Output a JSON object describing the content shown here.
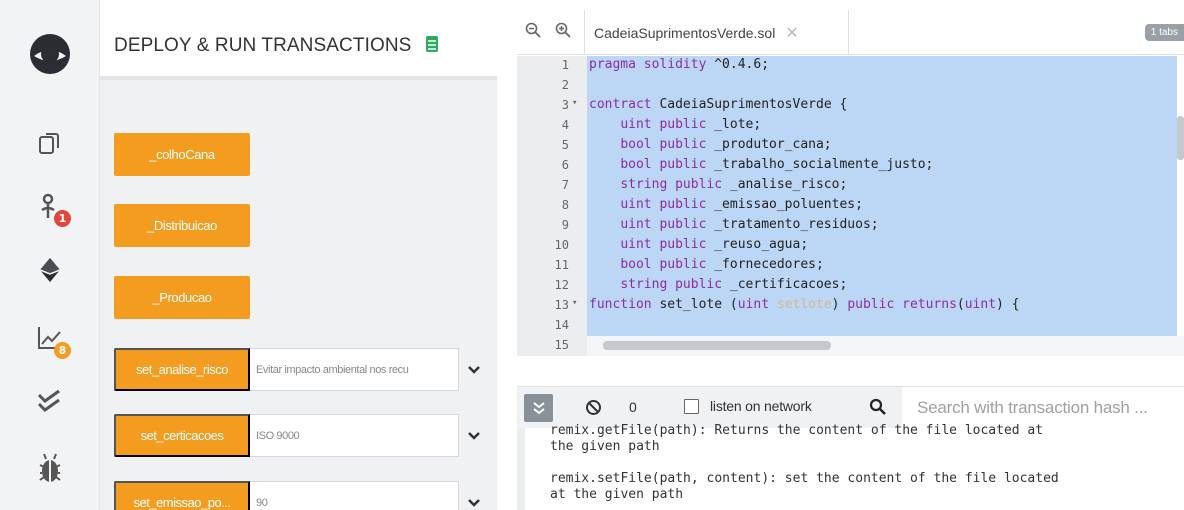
{
  "panel": {
    "title": "DEPLOY & RUN TRANSACTIONS",
    "buttons": [
      {
        "label": "_colhoCana"
      },
      {
        "label": "_Distribuicao"
      },
      {
        "label": "_Producao"
      }
    ],
    "rows": [
      {
        "label": "set_analise_risco",
        "value": "Evitar impacto ambiental nos recu"
      },
      {
        "label": "set_certicacoes",
        "value": "ISO 9000"
      },
      {
        "label": "set_emissao_po...",
        "value": "90"
      }
    ]
  },
  "rail": {
    "badges": {
      "plugin": "1",
      "analysis": "8"
    },
    "colors": {
      "badge_red": "#e2453c",
      "badge_orange": "#f39c1f"
    }
  },
  "editor": {
    "file_tab": "CadeiaSuprimentosVerde.sol",
    "tab_pill": "1 tabs",
    "lines": [
      {
        "n": "1",
        "fold": "",
        "parts": [
          [
            "kw",
            "pragma solidity "
          ],
          [
            "nm",
            "^0.4.6;"
          ]
        ]
      },
      {
        "n": "2",
        "fold": "",
        "parts": []
      },
      {
        "n": "3",
        "fold": "▾",
        "parts": [
          [
            "kw",
            "contract "
          ],
          [
            "nm",
            "CadeiaSuprimentosVerde {"
          ]
        ]
      },
      {
        "n": "4",
        "fold": "",
        "parts": [
          [
            "nm",
            "    "
          ],
          [
            "kw",
            "uint public "
          ],
          [
            "nm",
            "_lote;"
          ]
        ]
      },
      {
        "n": "5",
        "fold": "",
        "parts": [
          [
            "nm",
            "    "
          ],
          [
            "kw",
            "bool public "
          ],
          [
            "nm",
            "_produtor_cana;"
          ]
        ]
      },
      {
        "n": "6",
        "fold": "",
        "parts": [
          [
            "nm",
            "    "
          ],
          [
            "kw",
            "bool public "
          ],
          [
            "nm",
            "_trabalho_socialmente_justo;"
          ]
        ]
      },
      {
        "n": "7",
        "fold": "",
        "parts": [
          [
            "nm",
            "    "
          ],
          [
            "kw",
            "string public "
          ],
          [
            "nm",
            "_analise_risco;"
          ]
        ]
      },
      {
        "n": "8",
        "fold": "",
        "parts": [
          [
            "nm",
            "    "
          ],
          [
            "kw",
            "uint public "
          ],
          [
            "nm",
            "_emissao_poluentes;"
          ]
        ]
      },
      {
        "n": "9",
        "fold": "",
        "parts": [
          [
            "nm",
            "    "
          ],
          [
            "kw",
            "uint public "
          ],
          [
            "nm",
            "_tratamento_residuos;"
          ]
        ]
      },
      {
        "n": "10",
        "fold": "",
        "parts": [
          [
            "nm",
            "    "
          ],
          [
            "kw",
            "uint public "
          ],
          [
            "nm",
            "_reuso_agua;"
          ]
        ]
      },
      {
        "n": "11",
        "fold": "",
        "parts": [
          [
            "nm",
            "    "
          ],
          [
            "kw",
            "bool public "
          ],
          [
            "nm",
            "_fornecedores;"
          ]
        ]
      },
      {
        "n": "12",
        "fold": "",
        "parts": [
          [
            "nm",
            "    "
          ],
          [
            "kw",
            "string public "
          ],
          [
            "nm",
            "_certificacoes;"
          ]
        ]
      },
      {
        "n": "13",
        "fold": "▾",
        "parts": [
          [
            "kw",
            "function "
          ],
          [
            "nm",
            "set_lote ("
          ],
          [
            "kw",
            "uint "
          ],
          [
            "hl",
            "setlote"
          ],
          [
            "nm",
            ") "
          ],
          [
            "kw",
            "public returns"
          ],
          [
            "nm",
            "("
          ],
          [
            "kw",
            "uint"
          ],
          [
            "nm",
            ") {"
          ]
        ]
      },
      {
        "n": "14",
        "fold": "",
        "parts": []
      },
      {
        "n": "15",
        "fold": "",
        "parts": []
      }
    ]
  },
  "terminal": {
    "count": "0",
    "listen_label": "listen on network",
    "search_placeholder": "Search with transaction hash ...",
    "output": [
      "remix.getFile(path): Returns the content of the file located at",
      "the given path",
      "",
      "remix.setFile(path, content): set the content of the file located",
      "at the given path"
    ]
  }
}
